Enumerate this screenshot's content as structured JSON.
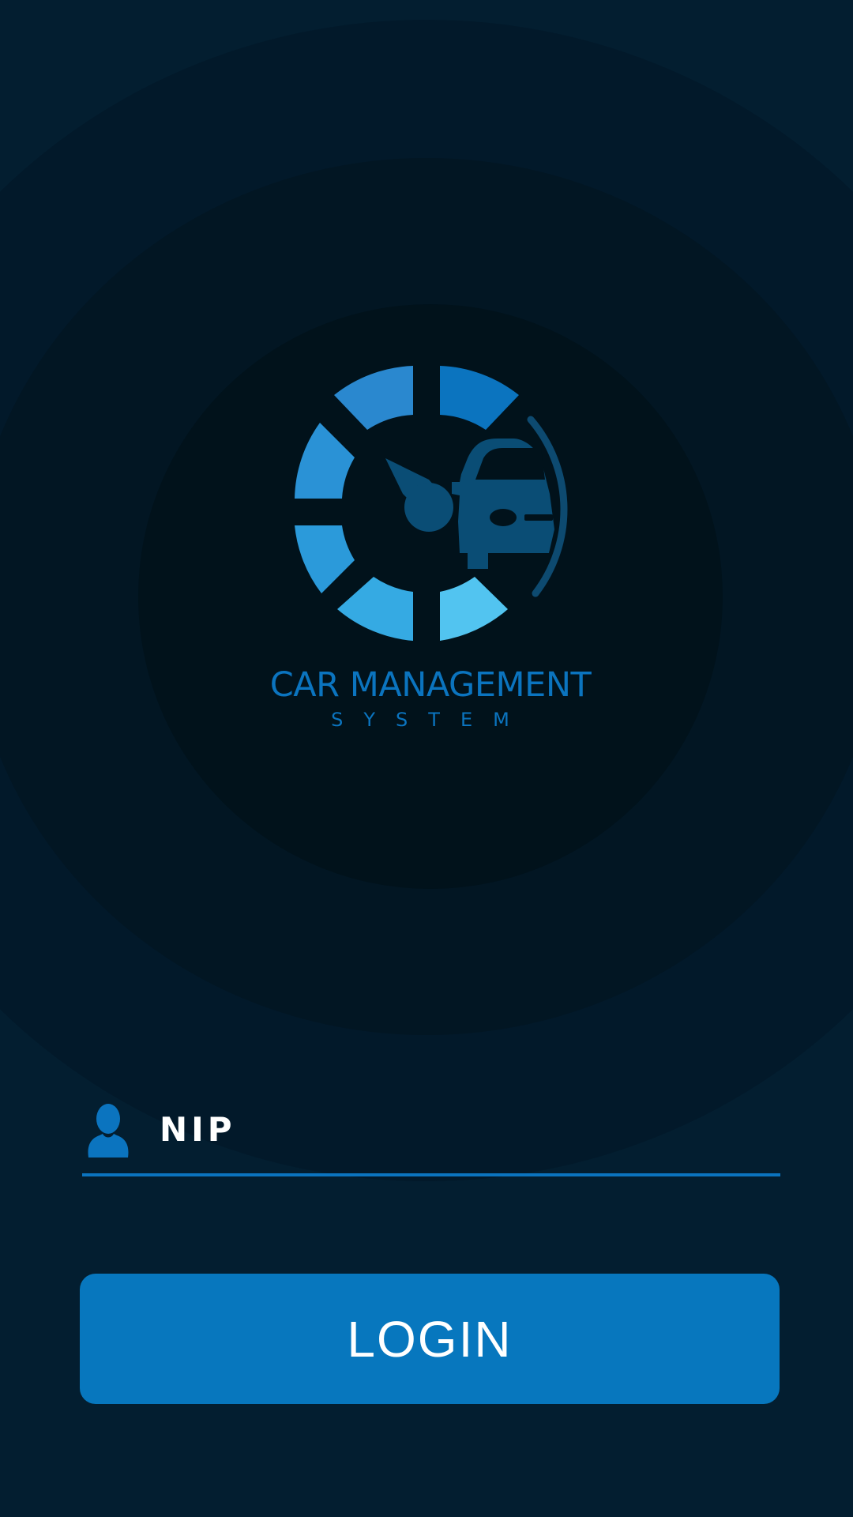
{
  "brand": {
    "title": "CAR MANAGEMENT",
    "subtitle": "SYSTEM",
    "logo_icon": "speedometer-car-icon"
  },
  "form": {
    "nip_placeholder": "NIP",
    "nip_value": "",
    "user_icon": "user-icon",
    "login_label": "LOGIN"
  },
  "colors": {
    "background": "#031e30",
    "accent": "#0b74bf",
    "button": "#0777be",
    "text": "#ffffff"
  }
}
